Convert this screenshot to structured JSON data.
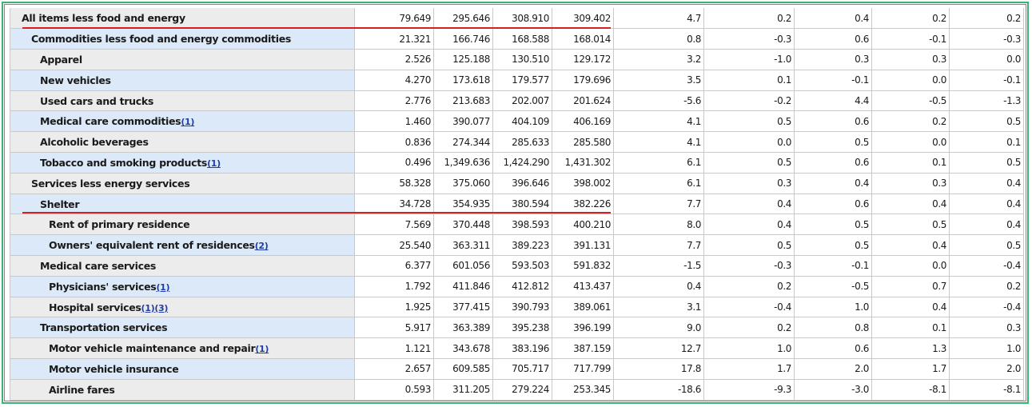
{
  "colors": {
    "border": "#3cb371",
    "shade": "#dce9f8",
    "plain": "#ececec",
    "highlight": "#d62020",
    "footnote_link": "#1f3ea8"
  },
  "rows": [
    {
      "label": "All items less food and energy",
      "level": 0,
      "footnotes": [],
      "values": [
        "79.649",
        "295.646",
        "308.910",
        "309.402",
        "4.7",
        "0.2",
        "0.4",
        "0.2",
        "0.2"
      ]
    },
    {
      "label": "Commodities less food and energy commodities",
      "level": 1,
      "footnotes": [],
      "values": [
        "21.321",
        "166.746",
        "168.588",
        "168.014",
        "0.8",
        "-0.3",
        "0.6",
        "-0.1",
        "-0.3"
      ]
    },
    {
      "label": "Apparel",
      "level": 2,
      "footnotes": [],
      "values": [
        "2.526",
        "125.188",
        "130.510",
        "129.172",
        "3.2",
        "-1.0",
        "0.3",
        "0.3",
        "0.0"
      ]
    },
    {
      "label": "New vehicles",
      "level": 2,
      "footnotes": [],
      "values": [
        "4.270",
        "173.618",
        "179.577",
        "179.696",
        "3.5",
        "0.1",
        "-0.1",
        "0.0",
        "-0.1"
      ]
    },
    {
      "label": "Used cars and trucks",
      "level": 2,
      "footnotes": [],
      "values": [
        "2.776",
        "213.683",
        "202.007",
        "201.624",
        "-5.6",
        "-0.2",
        "4.4",
        "-0.5",
        "-1.3"
      ]
    },
    {
      "label": "Medical care commodities",
      "level": 2,
      "footnotes": [
        "(1)"
      ],
      "values": [
        "1.460",
        "390.077",
        "404.109",
        "406.169",
        "4.1",
        "0.5",
        "0.6",
        "0.2",
        "0.5"
      ]
    },
    {
      "label": "Alcoholic beverages",
      "level": 2,
      "footnotes": [],
      "values": [
        "0.836",
        "274.344",
        "285.633",
        "285.580",
        "4.1",
        "0.0",
        "0.5",
        "0.0",
        "0.1"
      ]
    },
    {
      "label": "Tobacco and smoking products",
      "level": 2,
      "footnotes": [
        "(1)"
      ],
      "values": [
        "0.496",
        "1,349.636",
        "1,424.290",
        "1,431.302",
        "6.1",
        "0.5",
        "0.6",
        "0.1",
        "0.5"
      ]
    },
    {
      "label": "Services less energy services",
      "level": 1,
      "footnotes": [],
      "values": [
        "58.328",
        "375.060",
        "396.646",
        "398.002",
        "6.1",
        "0.3",
        "0.4",
        "0.3",
        "0.4"
      ]
    },
    {
      "label": "Shelter",
      "level": 2,
      "footnotes": [],
      "values": [
        "34.728",
        "354.935",
        "380.594",
        "382.226",
        "7.7",
        "0.4",
        "0.6",
        "0.4",
        "0.4"
      ]
    },
    {
      "label": "Rent of primary residence",
      "level": 3,
      "footnotes": [],
      "values": [
        "7.569",
        "370.448",
        "398.593",
        "400.210",
        "8.0",
        "0.4",
        "0.5",
        "0.5",
        "0.4"
      ]
    },
    {
      "label": "Owners' equivalent rent of residences",
      "level": 3,
      "footnotes": [
        "(2)"
      ],
      "values": [
        "25.540",
        "363.311",
        "389.223",
        "391.131",
        "7.7",
        "0.5",
        "0.5",
        "0.4",
        "0.5"
      ]
    },
    {
      "label": "Medical care services",
      "level": 2,
      "footnotes": [],
      "values": [
        "6.377",
        "601.056",
        "593.503",
        "591.832",
        "-1.5",
        "-0.3",
        "-0.1",
        "0.0",
        "-0.4"
      ]
    },
    {
      "label": "Physicians' services",
      "level": 3,
      "footnotes": [
        "(1)"
      ],
      "values": [
        "1.792",
        "411.846",
        "412.812",
        "413.437",
        "0.4",
        "0.2",
        "-0.5",
        "0.7",
        "0.2"
      ]
    },
    {
      "label": "Hospital services",
      "level": 3,
      "footnotes": [
        "(1)",
        "(3)"
      ],
      "values": [
        "1.925",
        "377.415",
        "390.793",
        "389.061",
        "3.1",
        "-0.4",
        "1.0",
        "0.4",
        "-0.4"
      ]
    },
    {
      "label": "Transportation services",
      "level": 2,
      "footnotes": [],
      "values": [
        "5.917",
        "363.389",
        "395.238",
        "396.199",
        "9.0",
        "0.2",
        "0.8",
        "0.1",
        "0.3"
      ]
    },
    {
      "label": "Motor vehicle maintenance and repair",
      "level": 3,
      "footnotes": [
        "(1)"
      ],
      "values": [
        "1.121",
        "343.678",
        "383.196",
        "387.159",
        "12.7",
        "1.0",
        "0.6",
        "1.3",
        "1.0"
      ]
    },
    {
      "label": "Motor vehicle insurance",
      "level": 3,
      "footnotes": [],
      "values": [
        "2.657",
        "609.585",
        "705.717",
        "717.799",
        "17.8",
        "1.7",
        "2.0",
        "1.7",
        "2.0"
      ]
    },
    {
      "label": "Airline fares",
      "level": 3,
      "footnotes": [],
      "values": [
        "0.593",
        "311.205",
        "279.224",
        "253.345",
        "-18.6",
        "-9.3",
        "-3.0",
        "-8.1",
        "-8.1"
      ]
    }
  ]
}
